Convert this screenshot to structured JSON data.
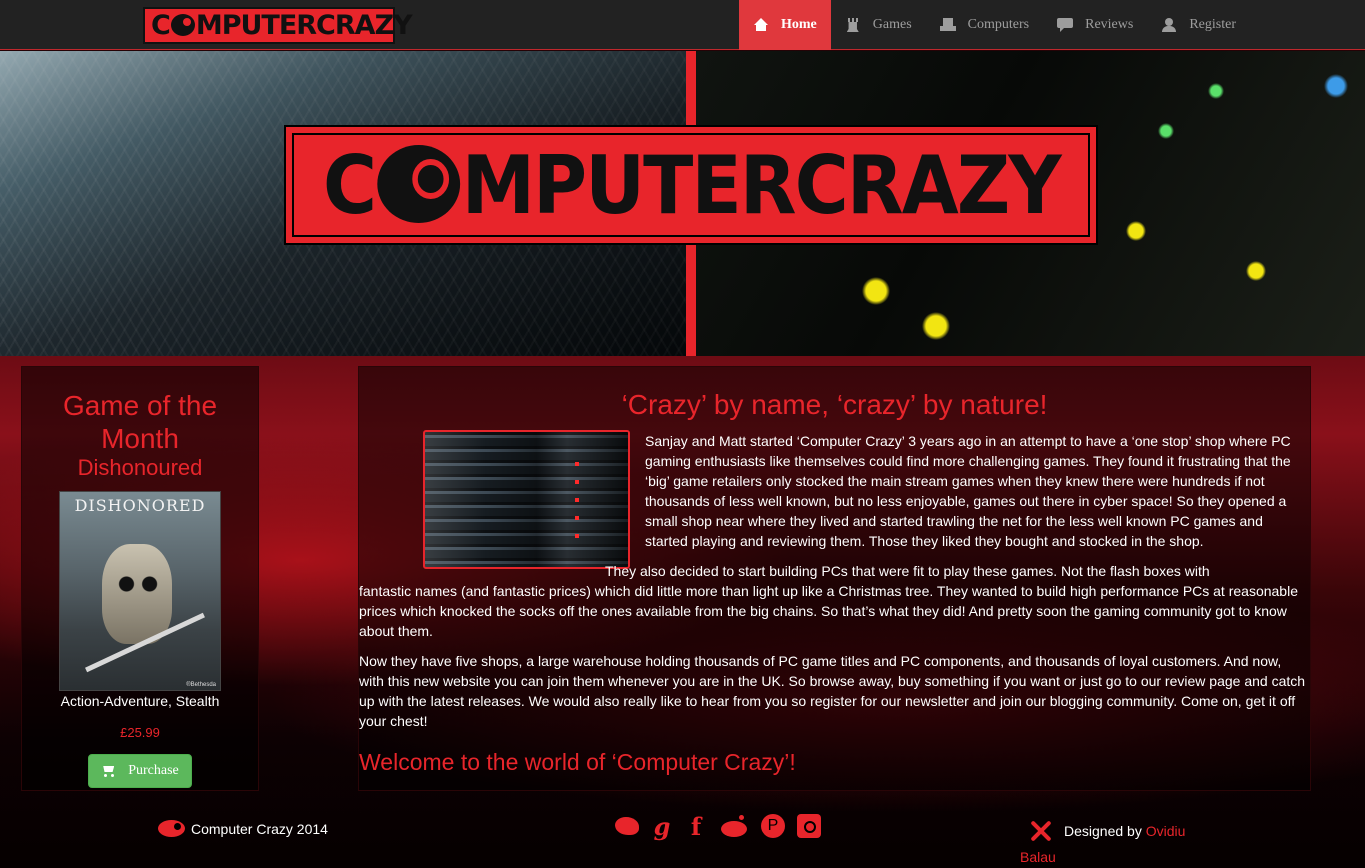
{
  "brand": {
    "logo_text_pre": "C",
    "logo_text_post": "MPUTERCRAZY"
  },
  "nav": {
    "items": [
      {
        "label": "Home",
        "icon": "home-icon",
        "active": true
      },
      {
        "label": "Games",
        "icon": "rook-icon",
        "active": false
      },
      {
        "label": "Computers",
        "icon": "hdd-icon",
        "active": false
      },
      {
        "label": "Reviews",
        "icon": "comment-icon",
        "active": false
      },
      {
        "label": "Register",
        "icon": "user-icon",
        "active": false
      }
    ]
  },
  "hero": {
    "logo_text_pre": "C",
    "logo_text_post": "MPUTERCRAZY"
  },
  "sidebar": {
    "heading": "Game of the Month",
    "game_name": "Dishonoured",
    "cover_title": "DISHONORED",
    "cover_publisher": "®Bethesda",
    "genre": "Action-Adventure, Stealth",
    "price": "£25.99",
    "purchase_label": "Purchase"
  },
  "main": {
    "title": "‘Crazy’ by name, ‘crazy’ by nature!",
    "paragraph1": "Sanjay and Matt started ‘Computer Crazy’ 3 years ago in an attempt to have a ‘one stop’ shop where PC gaming enthusiasts like themselves could find more challenging games. They found it frustrating that the ‘big’ game retailers only stocked the main stream games when they knew there were hundreds if not thousands of less well known, but no less enjoyable, games out there in cyber space! So they opened a small shop near where they lived and started trawling the net for the less well known PC games and started playing and reviewing them. Those they liked they bought and stocked in the shop.",
    "paragraph2_lead": "They also decided to start building PCs that were fit to play these games. Not the flash boxes with",
    "paragraph2_rest": "fantastic names (and fantastic prices) which did little more than light up like a Christmas tree. They wanted to build high performance PCs at reasonable prices which knocked the socks off the ones available from the big chains. So that’s what they did! And pretty soon the gaming community got to know about them.",
    "paragraph3": "Now they have five shops, a large warehouse holding thousands of PC game titles and PC components, and thousands of loyal customers. And now, with this new website you can join them whenever you are in the UK. So browse away, buy something if you want or just go to our review page and catch up with the latest releases. We would also really like to hear from you so register for our newsletter and join our blogging community. Come on, get it off your chest!",
    "welcome": "Welcome to the world of ‘Computer Crazy’!"
  },
  "footer": {
    "copyright": "Computer Crazy 2014",
    "social": [
      "twitter-icon",
      "google-plus-icon",
      "facebook-icon",
      "reddit-icon",
      "pinterest-icon",
      "instagram-icon"
    ],
    "google_glyph": "g",
    "facebook_glyph": "f",
    "pinterest_glyph": "P",
    "designed_by": "Designed by",
    "designer_first": "Ovidiu",
    "designer_last": "Balau"
  },
  "colors": {
    "accent": "#e8252b",
    "navbar": "#222222",
    "button_green": "#5cb85c"
  }
}
